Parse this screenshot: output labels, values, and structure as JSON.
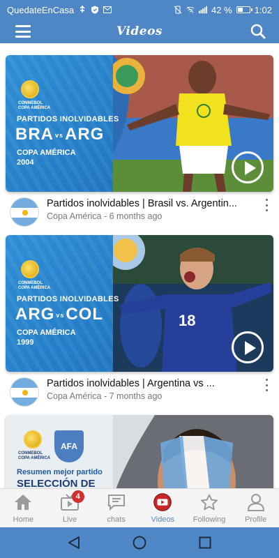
{
  "status_bar": {
    "carrier": "QuedateEnCasa",
    "battery_percent": "42 %",
    "battery_level": 0.42,
    "time": "1:02"
  },
  "app_bar": {
    "title": "Videos",
    "menu_icon": "menu-icon",
    "search_icon": "search-icon"
  },
  "videos": [
    {
      "thumb_subtitle": "PARTIDOS INOLVIDABLES",
      "team_a": "BRA",
      "vs": "vs",
      "team_b": "ARG",
      "thumb_competition": "COPA AMÉRICA",
      "thumb_year": "2004",
      "brand_line1": "CONMEBOL",
      "brand_line2": "COPA AMÉRICA",
      "title": "Partidos inolvidables | Brasil vs. Argentin...",
      "channel": "Copa América",
      "age": "6 months ago"
    },
    {
      "thumb_subtitle": "PARTIDOS INOLVIDABLES",
      "team_a": "ARG",
      "vs": "vs",
      "team_b": "COL",
      "thumb_competition": "COPA AMÉRICA",
      "thumb_year": "1999",
      "brand_line1": "CONMEBOL",
      "brand_line2": "COPA AMÉRICA",
      "title": "Partidos inolvidables | Argentina vs ...",
      "channel": "Copa América",
      "age": "7 months ago"
    },
    {
      "thumb_subtitle": "Resumen mejor partido",
      "thumb_headline": "SELECCIÓN DE",
      "brand_line1": "CONMEBOL",
      "brand_line2": "COPA AMÉRICA",
      "badge_text": "AFA"
    }
  ],
  "separator": " - ",
  "bottom_nav": [
    {
      "label": "Home",
      "icon": "home-icon"
    },
    {
      "label": "Live",
      "icon": "tv-icon",
      "badge": "4"
    },
    {
      "label": "chats",
      "icon": "chat-icon"
    },
    {
      "label": "Videos",
      "icon": "youtube-icon",
      "active": true
    },
    {
      "label": "Following",
      "icon": "star-icon"
    },
    {
      "label": "Profile",
      "icon": "person-icon"
    }
  ],
  "system_nav": [
    "back-icon",
    "home-circle-icon",
    "recents-icon"
  ],
  "colors": {
    "primary": "#4f86c6",
    "thumb_blue": "#1e74bf",
    "badge_red": "#d32f2f",
    "active_label": "#4f86c6"
  }
}
